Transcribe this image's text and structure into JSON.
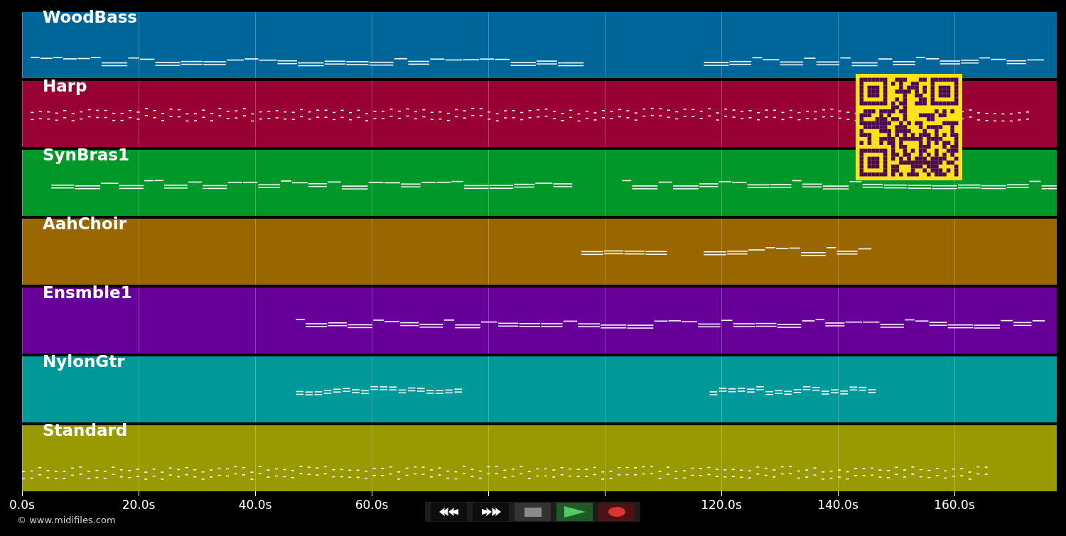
{
  "tracks": [
    {
      "name": "WoodBass",
      "color": "#006699"
    },
    {
      "name": "Harp",
      "color": "#990033"
    },
    {
      "name": "SynBras1",
      "color": "#009929"
    },
    {
      "name": "AahChoir",
      "color": "#996600"
    },
    {
      "name": "Ensmble1",
      "color": "#660099"
    },
    {
      "name": "NylonGtr",
      "color": "#009999"
    },
    {
      "name": "Standard",
      "color": "#999900"
    }
  ],
  "time_axis": {
    "labels": [
      "0.0s",
      "20.0s",
      "40.0s",
      "60.0s",
      "120.0s",
      "140.0s",
      "160.0s"
    ]
  },
  "transport": [
    {
      "kind": "rewind"
    },
    {
      "kind": "forward"
    },
    {
      "kind": "stop"
    },
    {
      "kind": "play"
    },
    {
      "kind": "record"
    }
  ],
  "copyright": "© www.midifiles.com"
}
